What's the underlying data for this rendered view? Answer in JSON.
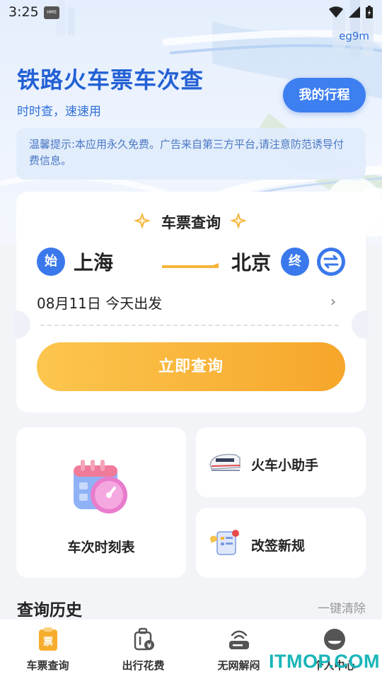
{
  "status_bar": {
    "time": "3:25",
    "hms_badge": "HMS"
  },
  "header": {
    "device_id": "eg9m",
    "title": "铁路火车票车次查",
    "subtitle": "时时查，速速用",
    "my_trip_label": "我的行程",
    "notice": "温馨提示:本应用永久免费。广告来自第三方平台,请注意防范诱导付费信息。"
  },
  "ticket_search": {
    "title": "车票查询",
    "from_badge": "始",
    "from_city": "上海",
    "to_city": "北京",
    "to_badge": "终",
    "date": "08月11日 今天出发",
    "search_label": "立即查询"
  },
  "features": {
    "timetable_label": "车次时刻表",
    "assistant_label": "火车小助手",
    "rebook_label": "改签新规"
  },
  "history": {
    "title": "查询历史",
    "clear_label": "一键清除"
  },
  "tabs": [
    {
      "label": "车票查询",
      "icon": "ticket-icon",
      "badge": "票"
    },
    {
      "label": "出行花费",
      "icon": "luggage-icon",
      "badge": "¥"
    },
    {
      "label": "无网解闷",
      "icon": "router-icon"
    },
    {
      "label": "个人中心",
      "icon": "profile-icon"
    }
  ],
  "watermark": "ITMOP.COM",
  "colors": {
    "primary": "#3a78ec",
    "accent": "#f6a62b",
    "title": "#2361d5"
  }
}
